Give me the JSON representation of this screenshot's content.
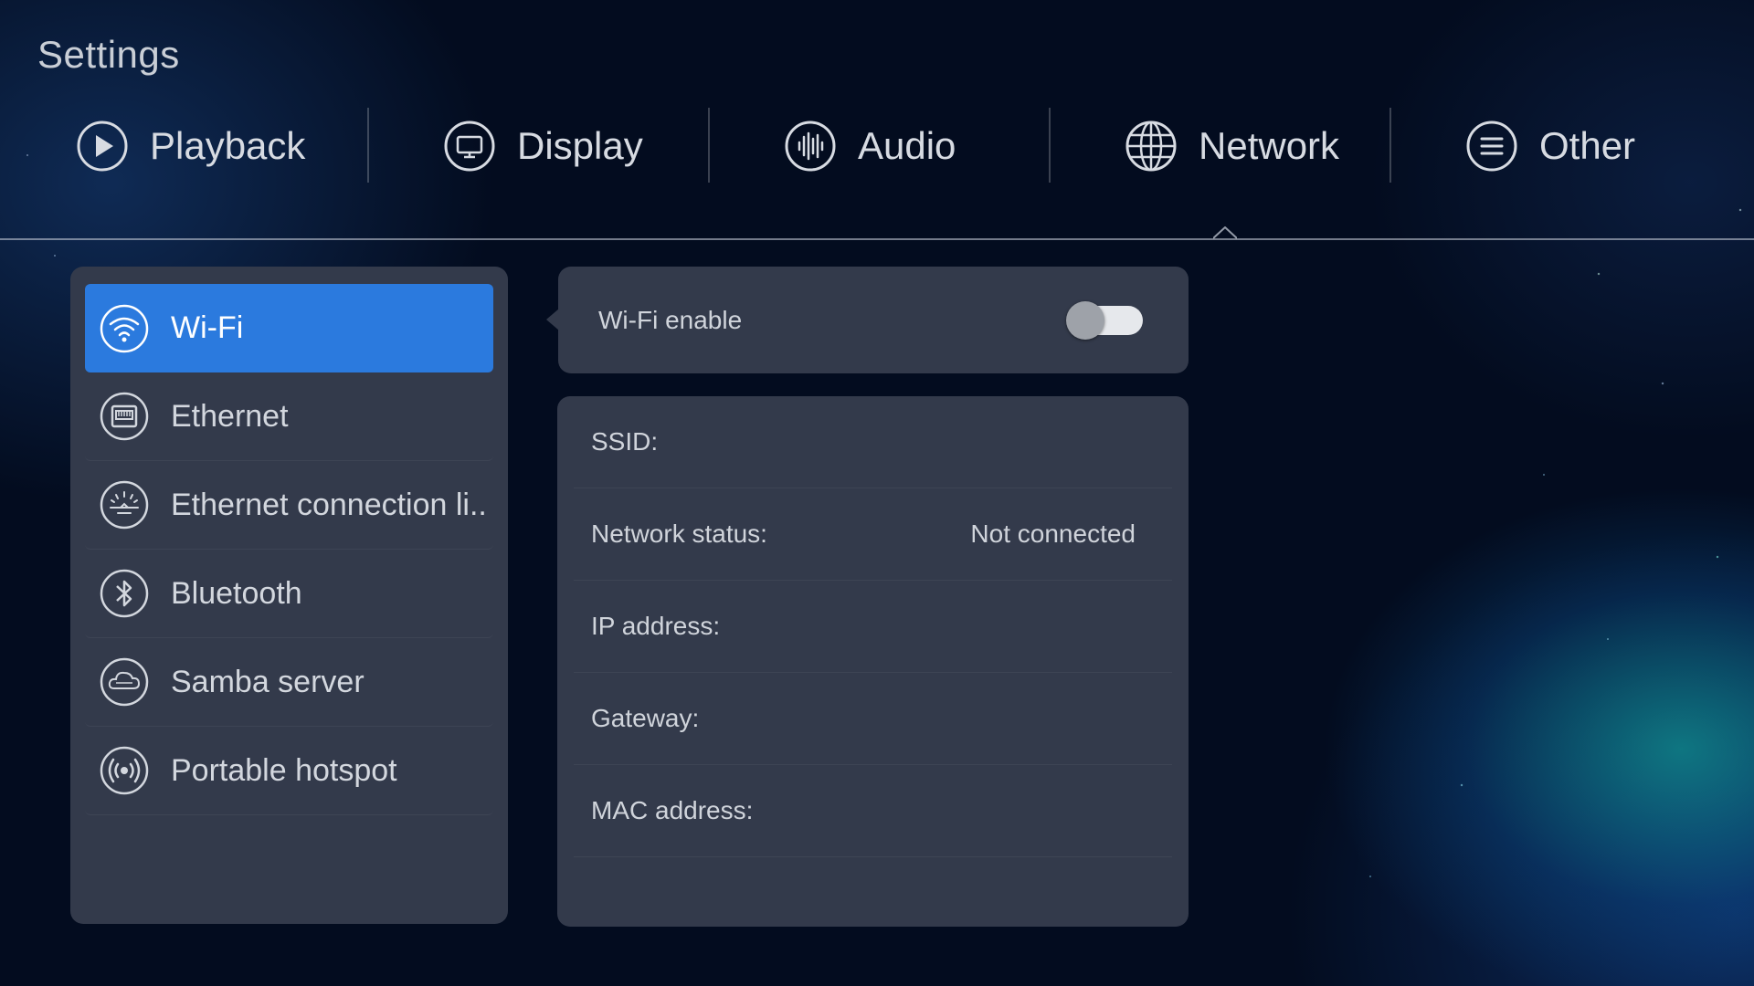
{
  "app": {
    "title": "Settings"
  },
  "tabs": [
    {
      "label": "Playback",
      "icon": "play-icon"
    },
    {
      "label": "Display",
      "icon": "monitor-icon"
    },
    {
      "label": "Audio",
      "icon": "audio-wave-icon"
    },
    {
      "label": "Network",
      "icon": "globe-icon",
      "active": true
    },
    {
      "label": "Other",
      "icon": "menu-icon"
    }
  ],
  "sidebar": {
    "items": [
      {
        "label": "Wi-Fi",
        "icon": "wifi-icon",
        "active": true
      },
      {
        "label": "Ethernet",
        "icon": "ethernet-icon"
      },
      {
        "label": "Ethernet connection li..",
        "icon": "ethernet-connection-icon"
      },
      {
        "label": "Bluetooth",
        "icon": "bluetooth-icon"
      },
      {
        "label": "Samba server",
        "icon": "samba-icon"
      },
      {
        "label": "Portable hotspot",
        "icon": "hotspot-icon"
      }
    ]
  },
  "wifi": {
    "enable_label": "Wi-Fi enable",
    "enabled": false
  },
  "info": {
    "rows": [
      {
        "label": "SSID:",
        "value": ""
      },
      {
        "label": "Network status:",
        "value": "Not connected"
      },
      {
        "label": "IP address:",
        "value": ""
      },
      {
        "label": "Gateway:",
        "value": ""
      },
      {
        "label": "MAC address:",
        "value": ""
      }
    ]
  },
  "colors": {
    "accent": "#2b7ade",
    "panel": "#333a4b",
    "background": "#030c1f"
  }
}
